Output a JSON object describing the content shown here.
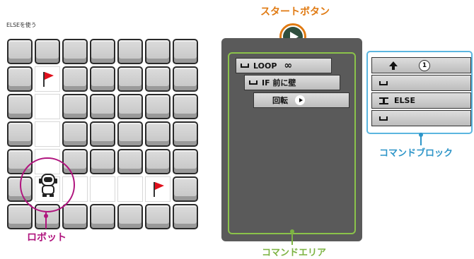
{
  "title": "ELSEを使う",
  "labels": {
    "start_button": "スタートボタン",
    "robot": "ロボット",
    "command_area": "コマンドエリア",
    "command_block": "コマンドブロック"
  },
  "program": [
    {
      "icon": "bracket-icon",
      "text": "LOOP",
      "extra": "∞"
    },
    {
      "icon": "bracket-icon",
      "text": "IF 前に壁",
      "extra": ""
    },
    {
      "icon": "",
      "text": "回転",
      "extra": "turn"
    }
  ],
  "palette": [
    {
      "icon": "arrow-up-icon",
      "text": "",
      "number": "1"
    },
    {
      "icon": "bracket-icon",
      "text": ""
    },
    {
      "icon": "ibeam-icon",
      "text": "ELSE"
    },
    {
      "icon": "bracket-icon",
      "text": ""
    }
  ],
  "colors": {
    "robot_accent": "#b0147e",
    "start_accent": "#e07a12",
    "command_area_accent": "#7cb342",
    "command_block_accent": "#2d95c8",
    "flag": "#e0101c"
  },
  "grid": {
    "rows": 7,
    "cols": 7,
    "map": [
      "BBBBBBB",
      "BFBBBBB",
      "B.BBBBB",
      "B.BBBBB",
      "B.BBBBB",
      "BR...FB",
      "BBBBBBB"
    ],
    "legend": {
      "B": "wall-block",
      ".": "floor",
      "F": "goal-flag",
      "R": "robot"
    }
  }
}
